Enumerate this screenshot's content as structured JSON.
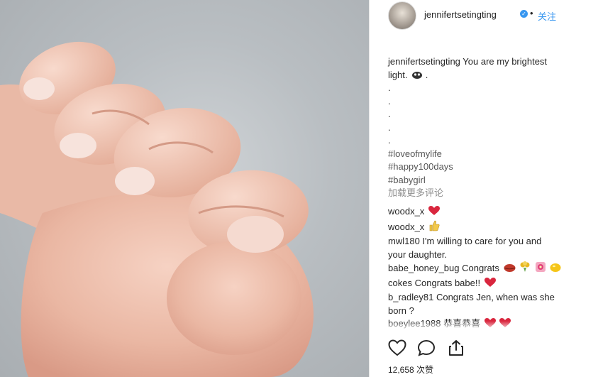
{
  "post": {
    "username": "jennifertsetingting",
    "separator": "•",
    "follow_label": "关注",
    "caption": {
      "username": "jennifertsetingting",
      "text_line1": "You are my brightest",
      "text_line2": "light.",
      "text_line2_suffix": ".",
      "dots": [
        ".",
        ".",
        ".",
        ".",
        "."
      ],
      "hashtags": [
        "#loveofmylife",
        "#happy100days",
        "#babygirl"
      ],
      "load_more": "加载更多评论"
    },
    "comments": [
      {
        "user": "woodx_x",
        "text": "",
        "emojis": [
          "heart-icon"
        ]
      },
      {
        "user": "woodx_x",
        "text": "",
        "emojis": [
          "thumbs-up-icon"
        ]
      },
      {
        "user": "mwl180",
        "text": "I'm willing to care for you and",
        "text2": "your daughter."
      },
      {
        "user": "babe_honey_bug",
        "text": "Congrats",
        "emojis": [
          "lips-icon",
          "bouquet-icon",
          "flower-icon",
          "lemon-icon"
        ]
      },
      {
        "user": "cokes",
        "text": "Congrats babe!!",
        "emojis": [
          "heart-icon"
        ]
      },
      {
        "user": "b_radley81",
        "text": "Congrats Jen, when was she",
        "text2": "born ?"
      },
      {
        "user": "boeylee1988",
        "text": "恭喜恭喜",
        "emojis": [
          "heart-icon",
          "heart-icon"
        ]
      }
    ],
    "likes": "12,658 次赞",
    "colors": {
      "link": "#3897f0",
      "text": "#262626",
      "muted": "#8e8e8e",
      "heart": "#e0245e"
    }
  }
}
